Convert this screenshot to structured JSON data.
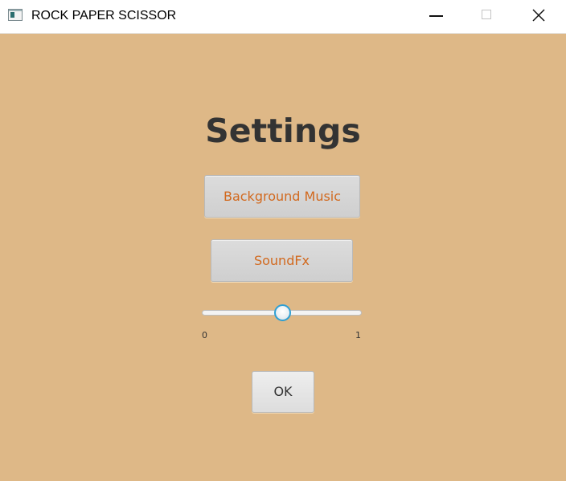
{
  "window": {
    "title": "ROCK PAPER SCISSOR",
    "background": "#deb887",
    "controls": {
      "minimize": "minimize-icon",
      "maximize": "maximize-icon",
      "close": "close-icon"
    }
  },
  "settings": {
    "heading": "Settings",
    "background_music_label": "Background Music",
    "soundfx_label": "SoundFx",
    "ok_label": "OK",
    "button_text_color": "#d2691e",
    "volume_slider": {
      "min_label": "0",
      "max_label": "1",
      "value": 0.5,
      "accent": "#2e9fd3"
    }
  }
}
